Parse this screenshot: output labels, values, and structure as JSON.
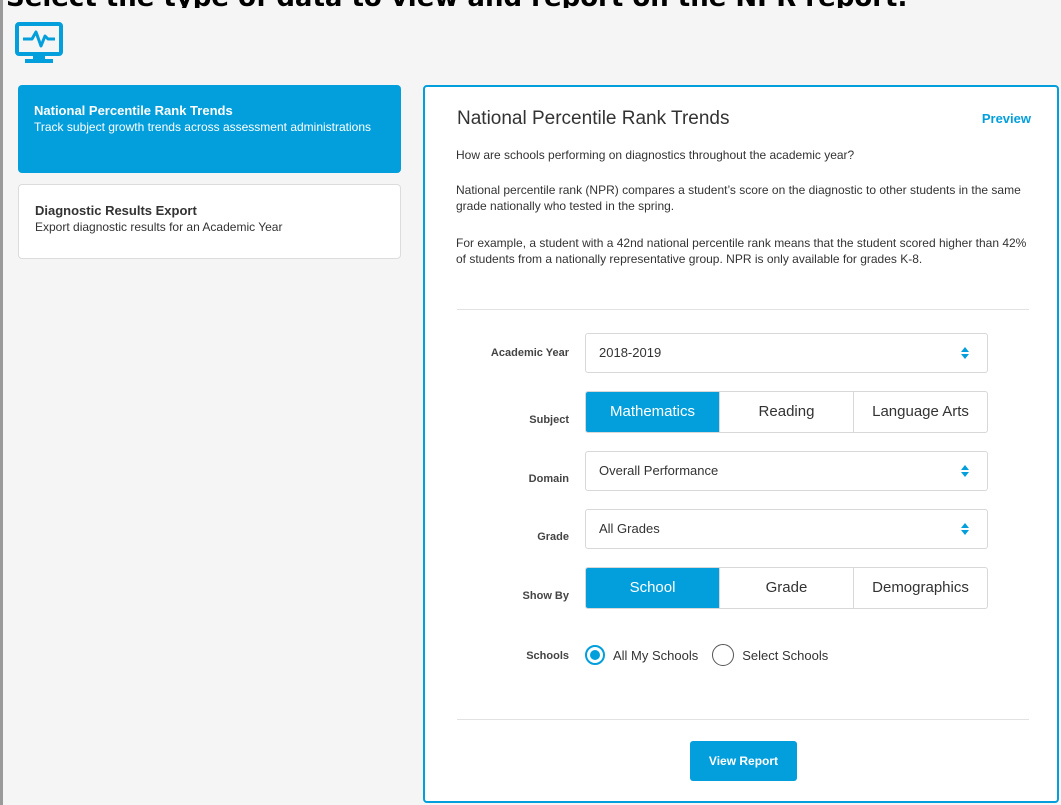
{
  "banner_text": "Select the type of data to view and report on the NPR report.",
  "logo": {
    "icon": "monitor-pulse-icon",
    "color": "#039fdc"
  },
  "sidebar": {
    "items": [
      {
        "title": "National Percentile Rank Trends",
        "description": "Track subject growth trends across assessment administrations",
        "active": true
      },
      {
        "title": "Diagnostic Results Export",
        "description": "Export diagnostic results for an Academic Year",
        "active": false
      }
    ]
  },
  "panel": {
    "title": "National Percentile Rank Trends",
    "preview_label": "Preview",
    "question": "How are schools performing on diagnostics throughout the academic year?",
    "definition": "National percentile rank (NPR) compares a student’s score on the diagnostic to other students in the same grade nationally who tested in the spring.",
    "example": "For example, a student with a 42nd national percentile rank means that the student scored higher than 42% of students from a nationally representative group. NPR is only available for grades K-8."
  },
  "form": {
    "academic_year": {
      "label": "Academic Year",
      "value": "2018-2019"
    },
    "subject": {
      "label": "Subject",
      "options": [
        "Mathematics",
        "Reading",
        "Language Arts"
      ],
      "selected": "Mathematics"
    },
    "domain": {
      "label": "Domain",
      "value": "Overall Performance"
    },
    "grade": {
      "label": "Grade",
      "value": "All Grades"
    },
    "show_by": {
      "label": "Show By",
      "options": [
        "School",
        "Grade",
        "Demographics"
      ],
      "selected": "School"
    },
    "schools": {
      "label": "Schools",
      "options": [
        "All My Schools",
        "Select Schools"
      ],
      "selected": "All My Schools"
    }
  },
  "view_report_label": "View Report",
  "colors": {
    "accent": "#039fdc",
    "background": "#f5f5f5"
  }
}
